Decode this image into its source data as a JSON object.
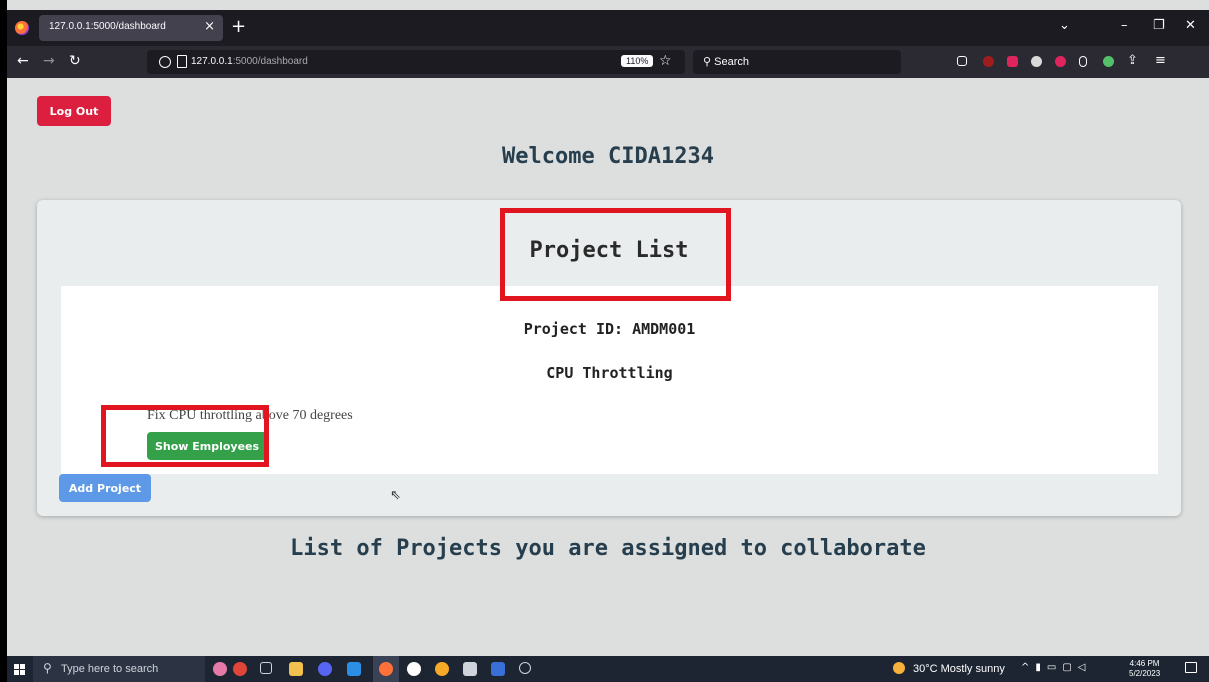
{
  "browser": {
    "tab_title": "127.0.0.1:5000/dashboard",
    "tab_close": "×",
    "new_tab": "+",
    "url_host": "127.0.0.1",
    "url_path": ":5000/dashboard",
    "zoom": "110%",
    "search_placeholder": "Search",
    "window_controls": [
      "⌄",
      "–",
      "❐",
      "✕"
    ]
  },
  "page": {
    "logout_label": "Log Out",
    "welcome": "Welcome CIDA1234",
    "project_list_title": "Project List",
    "projects": [
      {
        "id_label": "Project ID: AMDM001",
        "name": "CPU Throttling",
        "description": "Fix CPU throttling above 70 degrees",
        "show_employees_label": "Show Employees"
      }
    ],
    "add_project_label": "Add Project",
    "collab_heading": "List of Projects you are assigned to collaborate"
  },
  "taskbar": {
    "search_placeholder": "Type here to search",
    "weather": "30°C  Mostly sunny",
    "time": "4:46 PM",
    "date": "5/2/2023"
  },
  "colors": {
    "logout": "#dc1f3f",
    "show_employees": "#35a04a",
    "add_project": "#5e99e8",
    "highlight": "#e1151f"
  }
}
